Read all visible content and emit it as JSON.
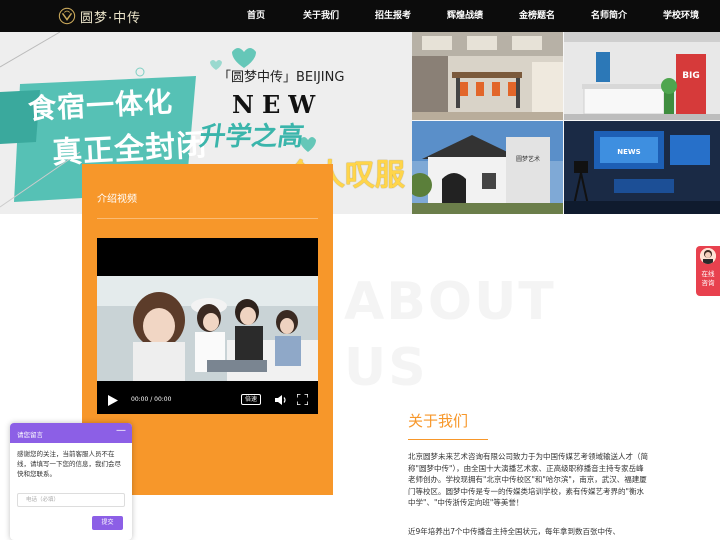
{
  "brand": {
    "logo_text": "圆梦·中传"
  },
  "nav": {
    "items": [
      {
        "label": "首页"
      },
      {
        "label": "关于我们"
      },
      {
        "label": "招生报考"
      },
      {
        "label": "辉煌战绩"
      },
      {
        "label": "金榜题名"
      },
      {
        "label": "名师简介"
      },
      {
        "label": "学校环境"
      }
    ]
  },
  "banner": {
    "line1": "食宿一体化",
    "line2": "真正全封闭",
    "title": "「圆梦中传」BEIJING",
    "new_word": "NEW",
    "slogan1": "升学之高",
    "slogan2": "个人叹服",
    "photo_sign": "BIG",
    "photo_wall": "圆梦艺术",
    "photo_screen": "NEWS"
  },
  "video": {
    "card_title": "介绍视频",
    "time": "00:00 / 00:00",
    "speed_label": "倍速"
  },
  "about": {
    "watermark": [
      "ABOUT",
      "US"
    ],
    "heading": "关于我们",
    "paragraph": "北京圆梦未来艺术咨询有限公司致力于为中国传媒艺考领域输送人才（简称\"圆梦中传\"），由全国十大演播艺术家、正高级职称播音主持专家岳峰老师创办。学校现拥有\"北京中传校区\"和\"哈尔滨\"，南京，武汉、福建厦门等校区。圆梦中传是专一的传媒类培训学校，素有传媒艺考界的\"衡水中学\"、\"中传浙传定向班\"等美誉！",
    "paragraph2": "近9年培养出7个中传播音主持全国状元，每年拿到数百张中传、"
  },
  "consult": {
    "label_line1": "在线",
    "label_line2": "咨询"
  },
  "message_widget": {
    "title": "请您留言",
    "minimize": "—",
    "body": "感谢您的关注，当前客服人员不在线，请填写一下您的信息，我们会尽快和您联系。",
    "phone_placeholder": "电话（必填）",
    "submit_label": "提交"
  },
  "colors": {
    "accent_orange": "#f7972a",
    "nav_bg": "#0c0c0c",
    "widget_purple": "#8c5fe6",
    "consult_red": "#e8414e",
    "teal": "#3ab5ab"
  }
}
